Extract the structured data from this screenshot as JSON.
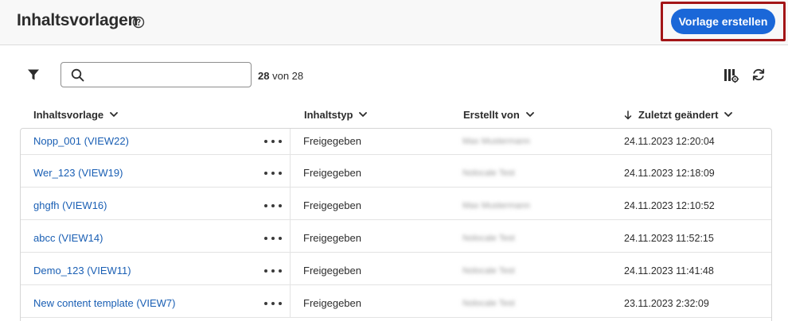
{
  "header": {
    "title": "Inhaltsvorlagen",
    "create_button": "Vorlage erstellen"
  },
  "toolbar": {
    "search_placeholder": "",
    "count_shown": "28",
    "count_rest": "von 28"
  },
  "columns": {
    "name": "Inhaltsvorlage",
    "type": "Inhaltstyp",
    "author": "Erstellt von",
    "modified": "Zuletzt geändert"
  },
  "rows": [
    {
      "name": "Nopp_001 (VIEW22)",
      "type": "Freigegeben",
      "author": "Max Mustermann",
      "modified": "24.11.2023 12:20:04"
    },
    {
      "name": "Wer_123 (VIEW19)",
      "type": "Freigegeben",
      "author": "Nolocale Test",
      "modified": "24.11.2023 12:18:09"
    },
    {
      "name": "ghgfh (VIEW16)",
      "type": "Freigegeben",
      "author": "Max Mustermann",
      "modified": "24.11.2023 12:10:52"
    },
    {
      "name": "abcc (VIEW14)",
      "type": "Freigegeben",
      "author": "Nolocale Test",
      "modified": "24.11.2023 11:52:15"
    },
    {
      "name": "Demo_123 (VIEW11)",
      "type": "Freigegeben",
      "author": "Nolocale Test",
      "modified": "24.11.2023 11:41:48"
    },
    {
      "name": "New content template (VIEW7)",
      "type": "Freigegeben",
      "author": "Nolocale Test",
      "modified": "23.11.2023 2:32:09"
    }
  ],
  "colors": {
    "accent": "#1a67d8",
    "link": "#1a5fb4",
    "highlight": "#a31517"
  }
}
